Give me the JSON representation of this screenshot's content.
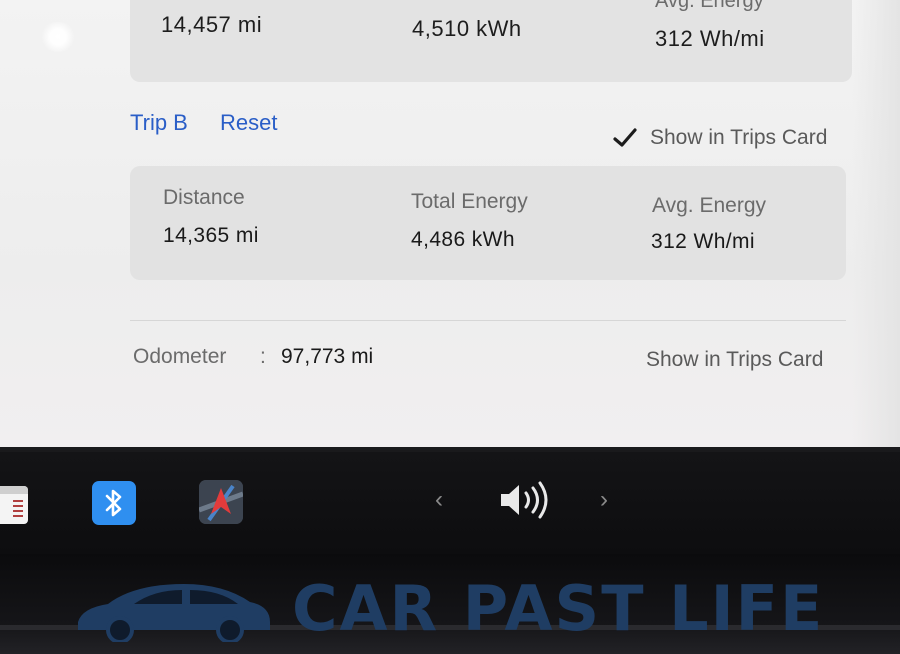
{
  "trip_a": {
    "distance_value": "14,457 mi",
    "energy_value": "4,510 kWh",
    "avg_label": "Avg. Energy",
    "avg_value": "312 Wh/mi"
  },
  "trip_b": {
    "title": "Trip B",
    "reset_label": "Reset",
    "show_in_trips_card_label": "Show in Trips Card",
    "show_in_trips_card_checked": true,
    "distance_label": "Distance",
    "distance_value": "14,365 mi",
    "energy_label": "Total Energy",
    "energy_value": "4,486 kWh",
    "avg_label": "Avg. Energy",
    "avg_value": "312 Wh/mi"
  },
  "odometer": {
    "label": "Odometer",
    "separator": ":",
    "value": "97,773 mi",
    "show_in_trips_card_label": "Show in Trips Card"
  },
  "taskbar": {
    "icons": [
      "calendar-icon",
      "bluetooth-icon",
      "navigation-icon",
      "chevron-left-icon",
      "volume-icon",
      "chevron-right-icon"
    ],
    "arrow_left": "‹",
    "arrow_right": "›"
  },
  "watermark": {
    "text": "CAR PAST LIFE"
  },
  "colors": {
    "link_blue": "#2a5ec7",
    "bluetooth_blue": "#2f8ff0",
    "watermark_blue": "#1f3d63"
  }
}
